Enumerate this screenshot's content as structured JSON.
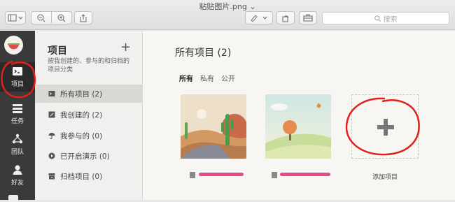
{
  "window": {
    "title": "粘贴图片.png ⌄"
  },
  "toolbar": {
    "search_placeholder": "搜索"
  },
  "rail": {
    "items": [
      {
        "label": "项目",
        "icon": "projects-icon"
      },
      {
        "label": "任务",
        "icon": "tasks-icon"
      },
      {
        "label": "团队",
        "icon": "team-icon"
      },
      {
        "label": "好友",
        "icon": "friends-icon"
      }
    ]
  },
  "sidebar": {
    "title": "项目",
    "add": "+",
    "description": "按我创建的、参与的和归档的项目分类",
    "items": [
      {
        "label": "所有项目 (2)",
        "icon": "folder-icon"
      },
      {
        "label": "我创建的 (2)",
        "icon": "edit-icon"
      },
      {
        "label": "我参与的 (0)",
        "icon": "umbrella-icon"
      },
      {
        "label": "已开启演示 (0)",
        "icon": "play-icon"
      },
      {
        "label": "归档项目 (0)",
        "icon": "archive-icon"
      }
    ]
  },
  "main": {
    "title": "所有项目 (2)",
    "filters": [
      "所有",
      "私有",
      "公开"
    ],
    "add_label": "添加项目"
  },
  "colors": {
    "rail_bg": "#3a3a3a",
    "annotation_red": "#e0201b"
  }
}
